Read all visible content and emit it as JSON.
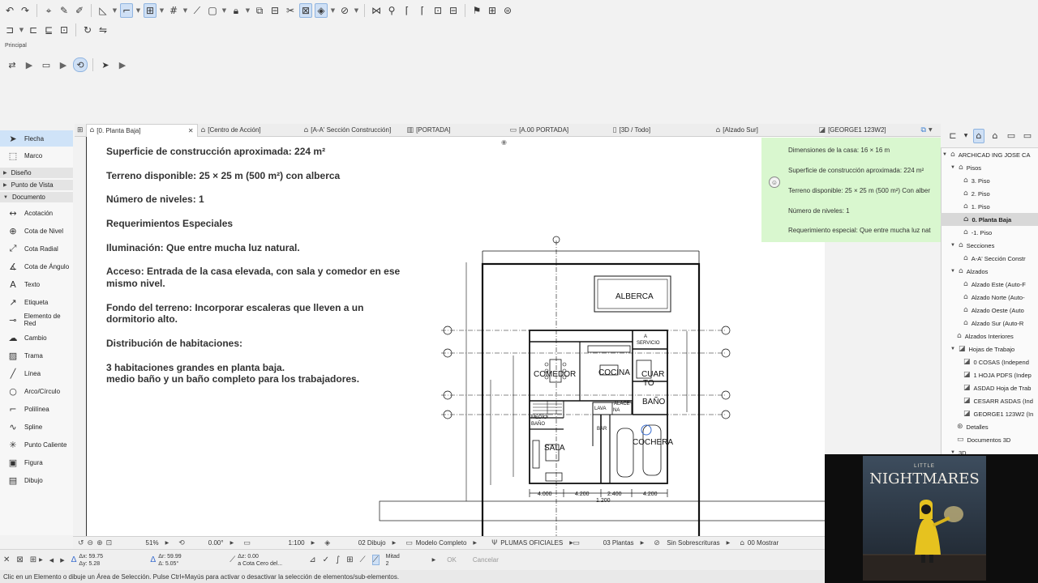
{
  "toolbar": {
    "row1_icons": [
      "undo-icon",
      "redo-icon",
      "pointer-icon",
      "pick-up-icon",
      "inject-icon",
      "layout-icon",
      "snap-icon",
      "magic-wand-icon",
      "grid-icon",
      "ruler-icon",
      "frame-icon",
      "lock-icon",
      "suspend-group-icon",
      "element-info-icon",
      "trim-icon",
      "renovation-icon",
      "layers-icon",
      "scissors-icon",
      "magnet-icon",
      "flag-icon",
      "marquee-icon",
      "tag-icon"
    ],
    "row2_icons": [
      "layer-icon",
      "copy-settings-icon",
      "paste-settings-icon",
      "attributes-icon",
      "rotate-icon",
      "mirror-icon"
    ]
  },
  "main_palette": {
    "label": "Principal"
  },
  "tabs": [
    {
      "label": "[0. Planta Baja]",
      "active": true
    },
    {
      "label": "[Centro de Acción]",
      "active": false
    },
    {
      "label": "[A-A' Sección Construcción]",
      "active": false
    },
    {
      "label": "[PORTADA]",
      "active": false
    },
    {
      "label": "[A.00 PORTADA]",
      "active": false
    },
    {
      "label": "[3D / Todo]",
      "active": false
    },
    {
      "label": "[Alzado Sur]",
      "active": false
    },
    {
      "label": "[GEORGE1 123W2]",
      "active": false
    }
  ],
  "toolbox": {
    "top_tools": [
      {
        "label": "Flecha",
        "icon": "arrow-icon",
        "selected": true
      },
      {
        "label": "Marco",
        "icon": "marquee-icon",
        "selected": false
      }
    ],
    "sections": [
      "Diseño",
      "Punto de Vista",
      "Documento"
    ],
    "doc_tools": [
      {
        "label": "Acotación",
        "icon": "dimension-icon"
      },
      {
        "label": "Cota de Nivel",
        "icon": "level-dimension-icon"
      },
      {
        "label": "Cota Radial",
        "icon": "radial-dimension-icon"
      },
      {
        "label": "Cota de Ángulo",
        "icon": "angle-dimension-icon"
      },
      {
        "label": "Texto",
        "icon": "text-icon"
      },
      {
        "label": "Etiqueta",
        "icon": "label-icon"
      },
      {
        "label": "Elemento de Red",
        "icon": "grid-element-icon"
      },
      {
        "label": "Cambio",
        "icon": "change-icon"
      },
      {
        "label": "Trama",
        "icon": "fill-icon"
      },
      {
        "label": "Línea",
        "icon": "line-icon"
      },
      {
        "label": "Arco/Círculo",
        "icon": "arc-icon"
      },
      {
        "label": "Polilínea",
        "icon": "polyline-icon"
      },
      {
        "label": "Spline",
        "icon": "spline-icon"
      },
      {
        "label": "Punto Caliente",
        "icon": "hotspot-icon"
      },
      {
        "label": "Figura",
        "icon": "figure-icon"
      },
      {
        "label": "Dibujo",
        "icon": "drawing-icon"
      }
    ]
  },
  "canvas_notes": [
    "Superficie de construcción aproximada: 224 m²",
    "Terreno disponible: 25 × 25 m (500 m²) con alberca",
    "Número de niveles: 1",
    " Requerimientos Especiales",
    "Iluminación: Que entre mucha luz natural.",
    "Acceso: Entrada de la casa elevada, con sala y comedor en ese",
    "mismo nivel.",
    "Fondo del terreno: Incorporar escaleras que lleven a un",
    "dormitorio alto.",
    "Distribución de habitaciones:",
    "3 habitaciones grandes en planta baja.",
    "medio baño y un baño completo para los trabajadores."
  ],
  "plan": {
    "rooms": [
      "ALBERCA",
      "COMEDOR",
      "COCINA",
      "CUAR",
      "TO",
      "BAÑO",
      "SALA",
      "COCHERA"
    ],
    "small_labels": [
      "A",
      "SERVICIO",
      "MEDIO",
      "BAÑO",
      "BAR",
      "LAVA",
      "NA",
      "ALACE"
    ],
    "dimensions": [
      "4.000",
      "4.200",
      "2.400",
      "4.200",
      "1.200"
    ]
  },
  "green_note": [
    "Dimensiones de la casa: 16 × 16 m",
    "Superficie de construcción aproximada: 224 m²",
    "Terreno disponible: 25 × 25 m (500 m²) Con alber",
    "Número de niveles: 1",
    "Requerimiento especial: Que entre mucha luz nat"
  ],
  "navigator": {
    "items": [
      {
        "label": "ARCHICAD ING JOSE CA",
        "level": 0,
        "expanded": true,
        "icon": "project-icon"
      },
      {
        "label": "Pisos",
        "level": 1,
        "expanded": true,
        "icon": "folder-icon"
      },
      {
        "label": "3. Piso",
        "level": 2,
        "icon": "story-icon"
      },
      {
        "label": "2. Piso",
        "level": 2,
        "icon": "story-icon"
      },
      {
        "label": "1. Piso",
        "level": 2,
        "icon": "story-icon"
      },
      {
        "label": "0. Planta Baja",
        "level": 2,
        "icon": "story-icon",
        "selected": true
      },
      {
        "label": "-1. Piso",
        "level": 2,
        "icon": "story-icon"
      },
      {
        "label": "Secciones",
        "level": 1,
        "expanded": true,
        "icon": "section-icon"
      },
      {
        "label": "A-A' Sección Constr",
        "level": 2,
        "icon": "section-view-icon"
      },
      {
        "label": "Alzados",
        "level": 1,
        "expanded": true,
        "icon": "elevation-icon"
      },
      {
        "label": "Alzado Este (Auto-F",
        "level": 2,
        "icon": "elevation-view-icon"
      },
      {
        "label": "Alzado Norte (Auto-",
        "level": 2,
        "icon": "elevation-view-icon"
      },
      {
        "label": "Alzado Oeste (Auto",
        "level": 2,
        "icon": "elevation-view-icon"
      },
      {
        "label": "Alzado Sur (Auto-R",
        "level": 2,
        "icon": "elevation-view-icon"
      },
      {
        "label": "Alzados Interiores",
        "level": 1,
        "icon": "interior-elevation-icon"
      },
      {
        "label": "Hojas de Trabajo",
        "level": 1,
        "expanded": true,
        "icon": "worksheet-icon"
      },
      {
        "label": "0 COSAS (Independ",
        "level": 2,
        "icon": "worksheet-icon"
      },
      {
        "label": "1 HOJA PDFS (Indep",
        "level": 2,
        "icon": "worksheet-icon"
      },
      {
        "label": "ASDAD Hoja de Trab",
        "level": 2,
        "icon": "worksheet-icon"
      },
      {
        "label": "CESARR ASDAS (Ind",
        "level": 2,
        "icon": "worksheet-icon"
      },
      {
        "label": "GEORGE1 123W2 (In",
        "level": 2,
        "icon": "worksheet-icon"
      },
      {
        "label": "Detalles",
        "level": 1,
        "icon": "details-icon"
      },
      {
        "label": "Documentos 3D",
        "level": 1,
        "icon": "documents-3d-icon"
      },
      {
        "label": "3D",
        "level": 1,
        "icon": "3d-icon"
      }
    ]
  },
  "view_bar": {
    "zoom": "51%",
    "angle": "0.00°",
    "scale": "1:100",
    "layer_combo": "02 Dibujo",
    "model_view": "Modelo Completo",
    "pen_set": "PLUMAS OFICIALES",
    "dim_style": "03 Plantas",
    "override": "Sin Sobrescrituras",
    "renovation": "00 Mostrar"
  },
  "info_bar": {
    "ax": "Δx: 59.75",
    "ay": "Δy: 5.28",
    "ar": "Δr: 59.99",
    "aa": "Δ: 5.05°",
    "az": "Δz: 0.00",
    "ref": "a Cota Cero del...",
    "mitad": "Mitad",
    "mitad_n": "2",
    "ok": "OK",
    "cancel": "Cancelar"
  },
  "status_text": "Clic en un Elemento o dibuje un Área de Selección. Pulse Ctrl+Mayús para activar o desactivar la selección de elementos/sub-elementos.",
  "webcam": {
    "little": "LITTLE",
    "title": "NIGHTMARES"
  }
}
